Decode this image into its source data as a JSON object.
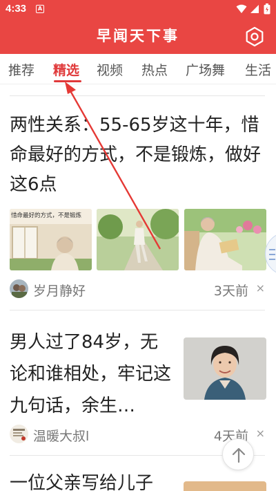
{
  "status_bar": {
    "time": "4:33",
    "notification_badge": "A"
  },
  "app": {
    "title": "早闻天下事"
  },
  "tabs": [
    {
      "label": "推荐",
      "active": false
    },
    {
      "label": "精选",
      "active": true
    },
    {
      "label": "视频",
      "active": false
    },
    {
      "label": "热点",
      "active": false
    },
    {
      "label": "广场舞",
      "active": false
    },
    {
      "label": "生活",
      "active": false
    }
  ],
  "feed": [
    {
      "title": "两性关系：55-65岁这十年，惜命最好的方式，不是锻炼，做好这6点",
      "thumbnail_caption": "惜命最好的方式，不是锻炼",
      "author": "岁月静好",
      "time_ago": "3天前",
      "close": "×"
    },
    {
      "title": "男人过了84岁，无论和谁相处，牢记这九句话，余生…",
      "author": "温暖大叔l",
      "time_ago": "4天前",
      "close": "×"
    },
    {
      "title": "一位父亲写给儿子"
    }
  ],
  "colors": {
    "brand_red": "#e94643",
    "active_tab": "#e0393a",
    "annotation_arrow": "#e53935"
  }
}
